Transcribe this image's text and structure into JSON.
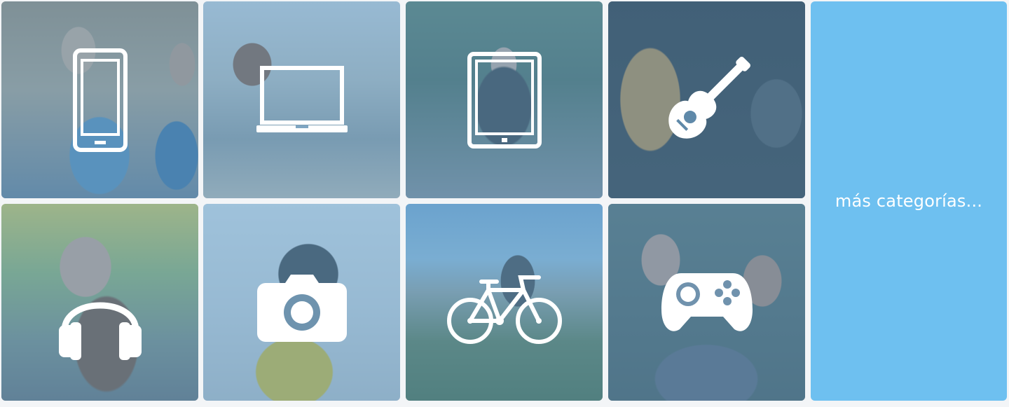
{
  "categories": [
    {
      "id": "phones",
      "icon": "smartphone-icon"
    },
    {
      "id": "computers",
      "icon": "laptop-icon"
    },
    {
      "id": "tablets",
      "icon": "tablet-icon"
    },
    {
      "id": "instruments",
      "icon": "guitar-icon"
    },
    {
      "id": "audio",
      "icon": "headphones-icon"
    },
    {
      "id": "photography",
      "icon": "camera-icon"
    },
    {
      "id": "sports",
      "icon": "bicycle-icon"
    },
    {
      "id": "gaming",
      "icon": "gamepad-icon"
    }
  ],
  "more": {
    "label": "más categorías..."
  },
  "colors": {
    "overlay": "#5896c3",
    "more_background": "#6ec0f0",
    "icon": "#ffffff"
  }
}
